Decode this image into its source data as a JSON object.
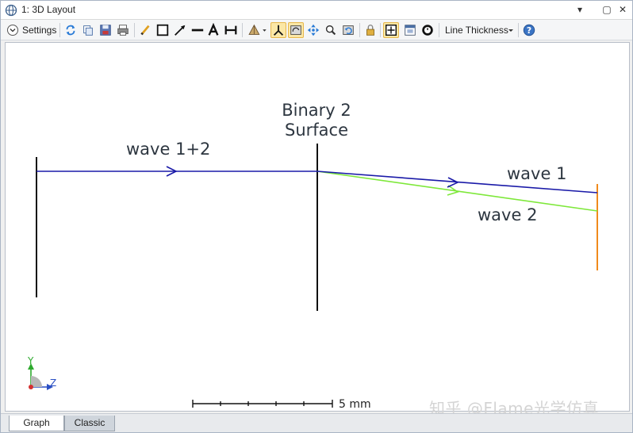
{
  "window": {
    "title": "1: 3D Layout",
    "controls": {
      "minimize": "▾",
      "restore": "▢",
      "close": "✕"
    }
  },
  "toolbar": {
    "settings_label": "Settings",
    "line_thickness_label": "Line Thickness",
    "icons": [
      "settings-chevron-icon",
      "refresh-icon",
      "copy-icon",
      "save-icon",
      "print-icon",
      "pencil-icon",
      "rectangle-icon",
      "arrow-icon",
      "line-icon",
      "text-icon",
      "dimension-icon",
      "rotate-view-icon",
      "axes-icon",
      "viewport-icon",
      "pan-icon",
      "zoom-icon",
      "reset-icon",
      "lock-icon",
      "fit-icon",
      "window-icon",
      "clock-icon",
      "help-icon"
    ]
  },
  "layout": {
    "labels": {
      "surface_line1": "Binary 2",
      "surface_line2": "Surface",
      "wave_combined": "wave 1+2",
      "wave1": "wave 1",
      "wave2": "wave 2"
    },
    "axes": {
      "y": "Y",
      "z": "Z"
    },
    "scale_bar_label": "5 mm",
    "colors": {
      "wave1": "#1a1aa8",
      "wave2": "#7ee83a",
      "surface": "#101010",
      "image_plane": "#f08a1c"
    }
  },
  "tabs": [
    {
      "label": "Graph",
      "active": true
    },
    {
      "label": "Classic",
      "active": false
    }
  ],
  "watermark": "知乎 @Flame光学仿真"
}
